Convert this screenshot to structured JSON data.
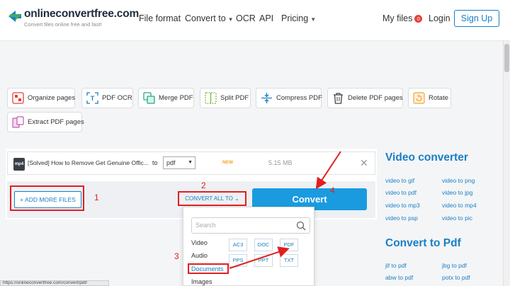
{
  "header": {
    "brand": "onlineconvertfree.com",
    "tagline": "Convert files online free and fast!",
    "nav": {
      "file_format": "File format",
      "convert_to": "Convert to",
      "ocr": "OCR",
      "api": "API",
      "pricing": "Pricing"
    },
    "my_files": "My files",
    "my_files_count": "0",
    "login": "Login",
    "signup": "Sign Up"
  },
  "tools": [
    "Organize pages",
    "PDF OCR",
    "Merge PDF",
    "Split PDF",
    "Compress PDF",
    "Delete PDF pages",
    "Rotate",
    "Extract PDF pages"
  ],
  "file": {
    "type_icon": "mp4",
    "name": "[Solved] How to Remove Get Genuine Offic...",
    "to_label": "to",
    "format": "pdf",
    "new_label": "NEW",
    "size": "5.15 MB"
  },
  "actions": {
    "add_more": "ADD MORE FILES",
    "convert_all": "CONVERT ALL TO",
    "convert": "Convert"
  },
  "format_dropdown": {
    "search_placeholder": "Search",
    "categories": [
      "Video",
      "Audio",
      "Documents",
      "Images"
    ],
    "formats": [
      "AC3",
      "DOC",
      "PDF",
      "PPS",
      "PPT",
      "TXT"
    ]
  },
  "sidebar": {
    "video_title": "Video converter",
    "video_links": [
      "video to gif",
      "video to png",
      "video to pdf",
      "video to jpg",
      "video to mp3",
      "video to mp4",
      "video to psp",
      "video to pic"
    ],
    "pdf_title": "Convert to Pdf",
    "pdf_links": [
      "jif to pdf",
      "jbg to pdf",
      "abw to pdf",
      "potx to pdf"
    ]
  },
  "status_url": "https://onlineconvertfree.com/convert/pdf/",
  "annotations": [
    "1",
    "2",
    "3",
    "4"
  ],
  "colors": {
    "brand_blue": "#1a7fc4",
    "convert_button": "#1a9be0",
    "annotation_red": "#e02020",
    "new_badge": "#f4a321"
  }
}
